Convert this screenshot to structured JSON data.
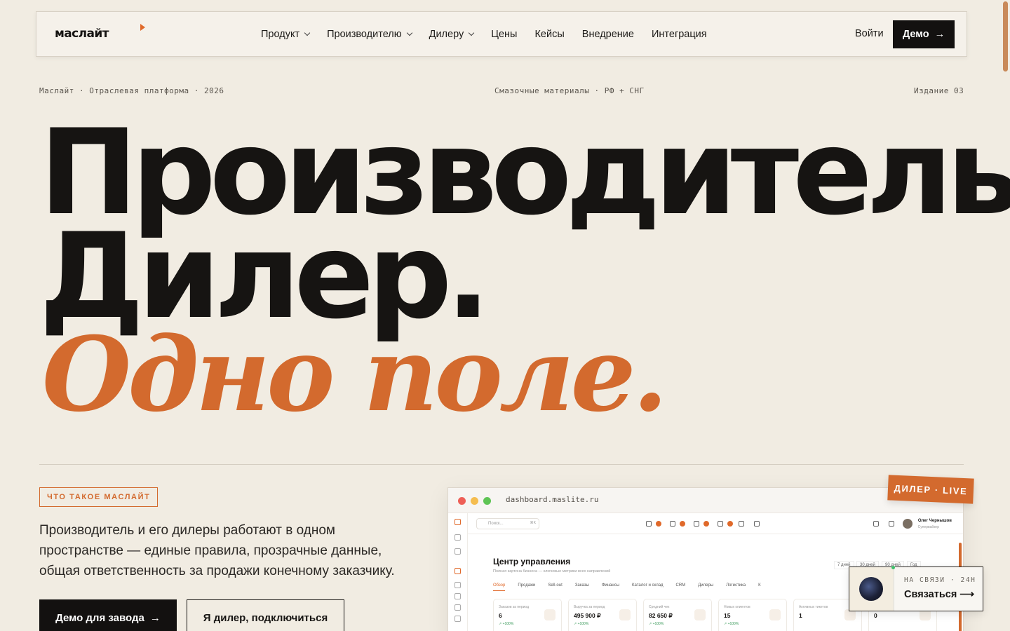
{
  "nav": {
    "logo": "маслайт",
    "menu": [
      {
        "label": "Продукт",
        "has_dropdown": true
      },
      {
        "label": "Производителю",
        "has_dropdown": true
      },
      {
        "label": "Дилеру",
        "has_dropdown": true
      },
      {
        "label": "Цены",
        "has_dropdown": false
      },
      {
        "label": "Кейсы",
        "has_dropdown": false
      },
      {
        "label": "Внедрение",
        "has_dropdown": false
      },
      {
        "label": "Интеграция",
        "has_dropdown": false
      }
    ],
    "login_label": "Войти",
    "demo_label": "Демо"
  },
  "meta": {
    "left": "Маслайт · Отраслевая платформа · 2026",
    "center": "Смазочные материалы · РФ + СНГ",
    "right": "Издание 03"
  },
  "hero": {
    "line1": "Производитель.",
    "line2": "Дилер.",
    "line3": "Одно поле."
  },
  "about": {
    "tag": "ЧТО ТАКОЕ МАСЛАЙТ",
    "description": "Производитель и его дилеры работают в одном пространстве — единые правила, прозрачные данные, общая ответственность за продажи конечному заказчику.",
    "btn_primary": "Демо для завода",
    "btn_secondary": "Я дилер, подключиться"
  },
  "browser": {
    "url": "dashboard.maslite.ru",
    "search_placeholder": "Поиск...",
    "search_hint": "⌘K",
    "user_name": "Олег Чернышов",
    "user_role": "Супервайзер",
    "title": "Центр управления",
    "subtitle": "Полная картина бизнеса — ключевые метрики всех направлений",
    "periods": [
      "7 дней",
      "30 дней",
      "90 дней",
      "Год"
    ],
    "tabs": [
      "Обзор",
      "Продажи",
      "Sell-out",
      "Заказы",
      "Финансы",
      "Каталог и склад",
      "CRM",
      "Дилеры",
      "Логистика",
      "К"
    ],
    "cards": [
      {
        "label": "Заказов за период",
        "value": "6",
        "delta": "↗ +100%"
      },
      {
        "label": "Выручка за период",
        "value": "495 900 ₽",
        "delta": "↗ +100%"
      },
      {
        "label": "Средний чек",
        "value": "82 650 ₽",
        "delta": "↗ +100%"
      },
      {
        "label": "Новых клиентов",
        "value": "15",
        "delta": "↗ +100%"
      },
      {
        "label": "Активных тикетов",
        "value": "1",
        "delta": ""
      },
      {
        "label": "",
        "value": "0",
        "delta": ""
      }
    ],
    "live_badge": "ДИЛЕР · LIVE"
  },
  "contact": {
    "label": "НА СВЯЗИ · 24Н",
    "action": "Связаться ⟶"
  },
  "colors": {
    "background": "#f1ece2",
    "accent": "#d36a2e",
    "ink": "#161412"
  }
}
